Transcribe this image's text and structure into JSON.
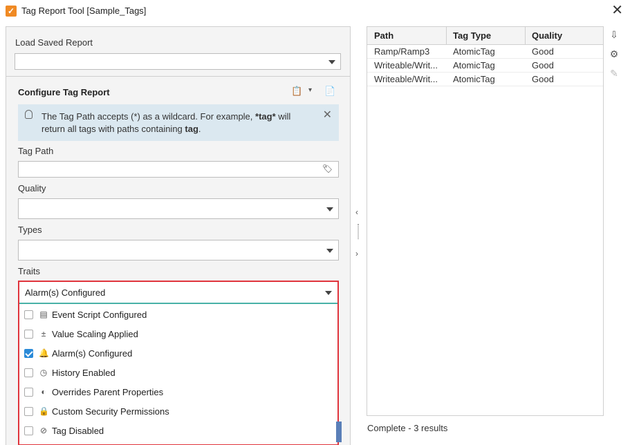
{
  "window": {
    "title": "Tag Report Tool [Sample_Tags]"
  },
  "load": {
    "label": "Load Saved Report",
    "value": ""
  },
  "config": {
    "title": "Configure Tag Report",
    "info_html_parts": [
      "The Tag Path accepts (*) as a wildcard. For example, ",
      "*tag*",
      " will return all tags with paths containing ",
      "tag",
      "."
    ],
    "tag_path_label": "Tag Path",
    "tag_path_value": "",
    "quality_label": "Quality",
    "types_label": "Types",
    "traits_label": "Traits",
    "traits_selected": "Alarm(s) Configured",
    "traits_options": [
      {
        "label": "Event Script Configured",
        "checked": false,
        "icon": "script-icon"
      },
      {
        "label": "Value Scaling Applied",
        "checked": false,
        "icon": "scaling-icon"
      },
      {
        "label": "Alarm(s) Configured",
        "checked": true,
        "icon": "bell-icon"
      },
      {
        "label": "History Enabled",
        "checked": false,
        "icon": "clock-icon"
      },
      {
        "label": "Overrides Parent Properties",
        "checked": false,
        "icon": "override-icon"
      },
      {
        "label": "Custom Security Permissions",
        "checked": false,
        "icon": "lock-icon"
      },
      {
        "label": "Tag Disabled",
        "checked": false,
        "icon": "disabled-icon"
      }
    ]
  },
  "results": {
    "columns": [
      "Path",
      "Tag Type",
      "Quality"
    ],
    "rows": [
      [
        "Ramp/Ramp3",
        "AtomicTag",
        "Good"
      ],
      [
        "Writeable/Writ...",
        "AtomicTag",
        "Good"
      ],
      [
        "Writeable/Writ...",
        "AtomicTag",
        "Good"
      ]
    ],
    "status": "Complete - 3 results"
  },
  "colors": {
    "highlight_border": "#e0343c",
    "info_bg": "#dbe8f0",
    "check": "#2a8ad8",
    "focus_line": "#49b1a7"
  }
}
